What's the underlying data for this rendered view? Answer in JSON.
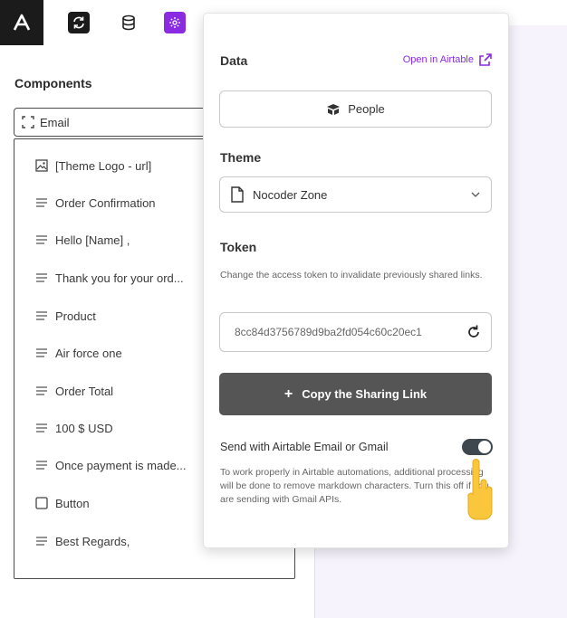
{
  "toolbar": {
    "brand_icon": "airtable-logo",
    "buttons": [
      "sync-icon",
      "database-icon",
      "gear-icon"
    ],
    "active_color": "#8a2be2"
  },
  "left_panel": {
    "title": "Components",
    "selected_component": "Email",
    "components": [
      {
        "icon": "image-icon",
        "label": "[Theme Logo - url]"
      },
      {
        "icon": "text-icon",
        "label": "Order Confirmation"
      },
      {
        "icon": "text-icon",
        "label": "Hello [Name] ,"
      },
      {
        "icon": "text-icon",
        "label": "Thank you for your ord..."
      },
      {
        "icon": "text-icon",
        "label": "Product"
      },
      {
        "icon": "text-icon",
        "label": "Air force one"
      },
      {
        "icon": "text-icon",
        "label": "Order Total"
      },
      {
        "icon": "text-icon",
        "label": "100 $ USD"
      },
      {
        "icon": "text-icon",
        "label": "Once payment is made..."
      },
      {
        "icon": "button-icon",
        "label": "Button"
      },
      {
        "icon": "text-icon",
        "label": "Best Regards,"
      }
    ]
  },
  "popover": {
    "data_label": "Data",
    "open_link": "Open in Airtable",
    "table_button": "People",
    "theme_label": "Theme",
    "theme_value": "Nocoder Zone",
    "token_label": "Token",
    "token_help": "Change the access token to invalidate previously shared links.",
    "token_value": "8cc84d3756789d9ba2fd054c60c20ec1",
    "copy_button": "Copy the Sharing Link",
    "send_label": "Send with Airtable Email or Gmail",
    "send_toggle_on": true,
    "send_help": "To work properly in Airtable automations, additional processing will be done to remove markdown characters. Turn this off if you are sending with Gmail APIs."
  }
}
